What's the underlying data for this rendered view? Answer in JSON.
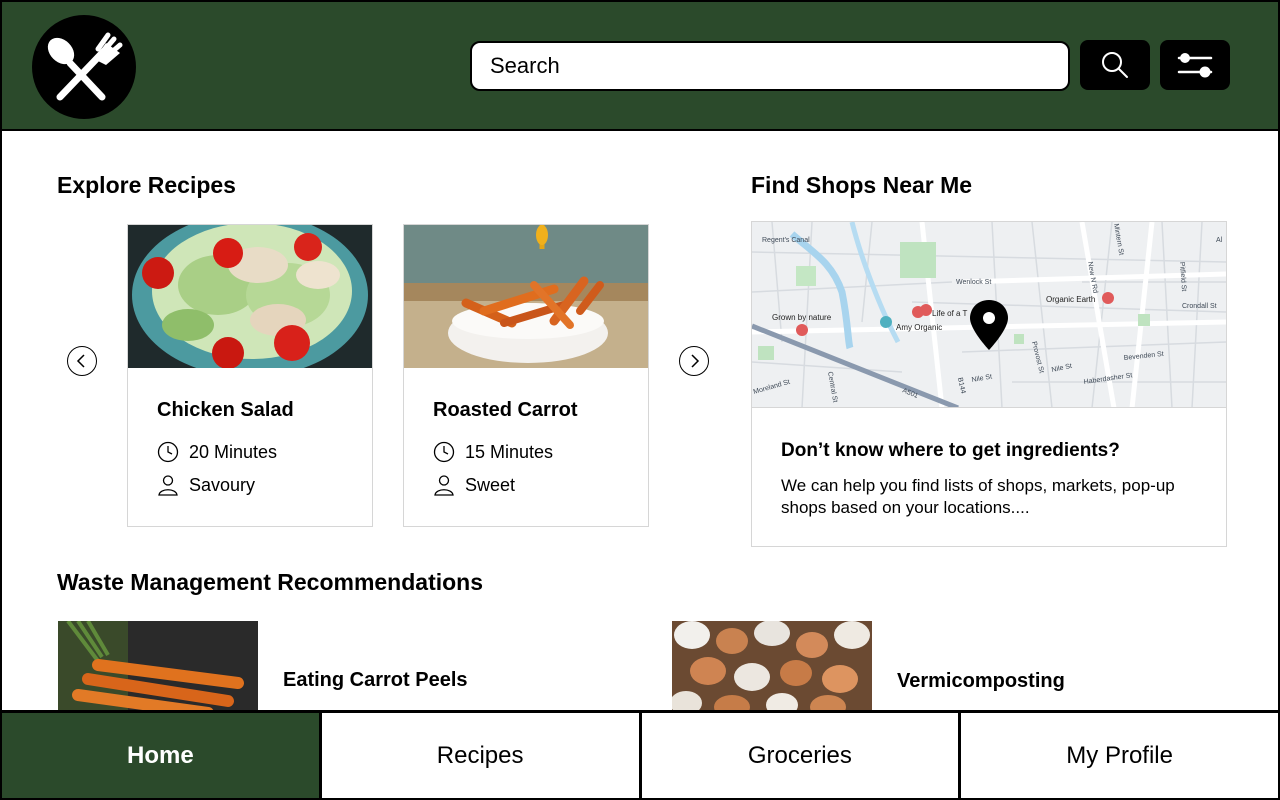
{
  "header": {
    "logo_icon": "spoon-fork-logo-icon",
    "search_placeholder": "Search",
    "search_icon": "search-icon",
    "filter_icon": "sliders-icon",
    "brand_color": "#2b4a2b"
  },
  "explore": {
    "title": "Explore Recipes",
    "recipes": [
      {
        "title": "Chicken Salad",
        "time": "20 Minutes",
        "type": "Savoury"
      },
      {
        "title": "Roasted Carrot",
        "time": "15 Minutes",
        "type": "Sweet"
      }
    ]
  },
  "shops": {
    "title": "Find Shops Near Me",
    "map_labels": {
      "regents_canal": "Regent's Canal",
      "wenlock_st": "Wenlock St",
      "new_n_rd": "New N Rd",
      "pitfield_st": "Pitfield St",
      "crondall_st": "Crondall St",
      "grown_by_nature": "Grown by nature",
      "amy_organic": "Amy Organic",
      "life_of_a_tree": "Life of a T",
      "organic_earth": "Organic Earth",
      "provost_st": "Provost St",
      "nile_st": "Nile St",
      "bevenden_st": "Bevenden St",
      "haberdasher_st": "Haberdasher St",
      "moreland_st": "Moreland St",
      "central_st": "Central St",
      "a501": "A501",
      "b144": "B144",
      "mintern_st": "Mintern St",
      "al": "Al"
    },
    "heading": "Don’t know where to get ingredients?",
    "description": "We can help you find lists of shops, markets, pop-up shops based on your locations...."
  },
  "waste": {
    "title": "Waste Management Recommendations",
    "items": [
      {
        "title": "Eating Carrot Peels"
      },
      {
        "title": "Vermicomposting"
      }
    ]
  },
  "nav": {
    "items": [
      "Home",
      "Recipes",
      "Groceries",
      "My Profile"
    ],
    "active": "Home"
  }
}
